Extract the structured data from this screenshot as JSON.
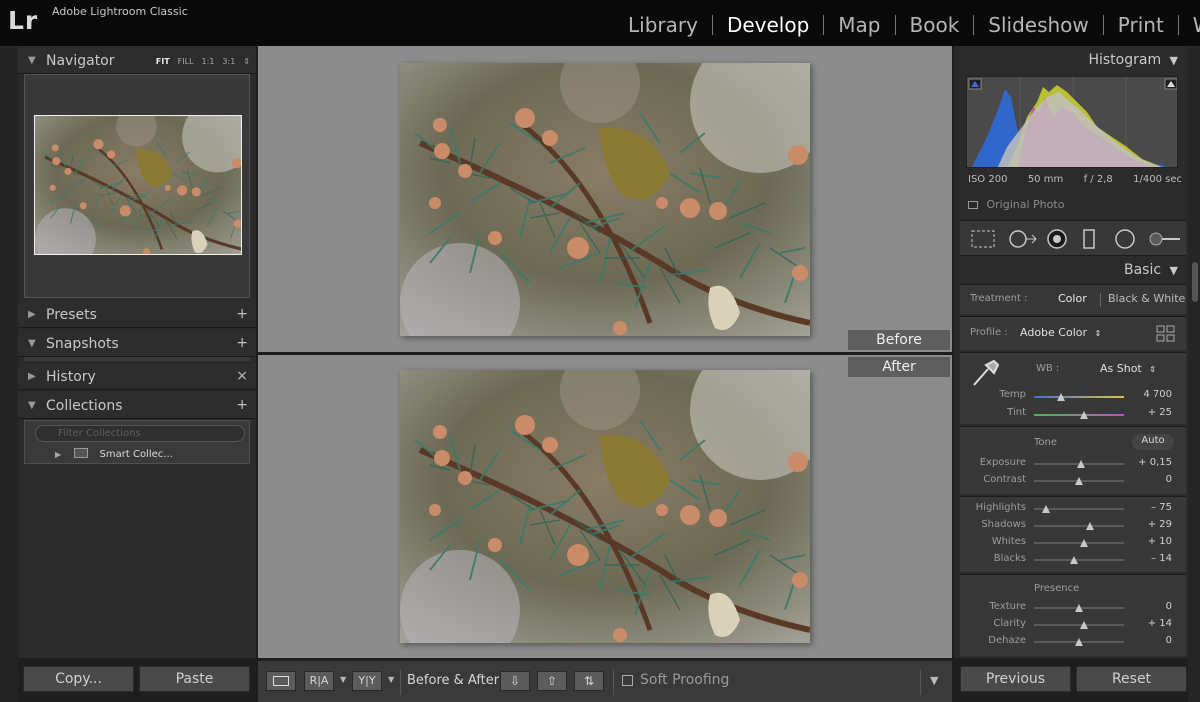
{
  "app": {
    "logo": "Lr",
    "name": "Adobe Lightroom Classic"
  },
  "modules": [
    {
      "label": "Library",
      "active": false
    },
    {
      "label": "Develop",
      "active": true
    },
    {
      "label": "Map",
      "active": false
    },
    {
      "label": "Book",
      "active": false
    },
    {
      "label": "Slideshow",
      "active": false
    },
    {
      "label": "Print",
      "active": false
    },
    {
      "label": "Web",
      "active": false
    }
  ],
  "left": {
    "navigator": {
      "title": "Navigator",
      "modes": [
        "FIT",
        "FILL",
        "1:1",
        "3:1"
      ]
    },
    "presets": {
      "title": "Presets",
      "action": "+"
    },
    "snapshots": {
      "title": "Snapshots",
      "action": "+"
    },
    "history": {
      "title": "History",
      "action": "×"
    },
    "collections": {
      "title": "Collections",
      "action": "+",
      "filter_placeholder": "Filter Collections",
      "items": [
        "Smart Collec..."
      ]
    },
    "copy_label": "Copy...",
    "paste_label": "Paste"
  },
  "center": {
    "before_label": "Before",
    "after_label": "After"
  },
  "toolbar": {
    "ra_label": "R|A",
    "yy_label": "Y|Y",
    "before_after_label": "Before & After :",
    "soft_proofing_label": "Soft Proofing"
  },
  "right": {
    "histogram": {
      "title": "Histogram",
      "iso": "ISO 200",
      "focal": "50 mm",
      "aperture": "f / 2,8",
      "shutter": "1/400 sec",
      "original_photo": "Original Photo"
    },
    "basic": {
      "title": "Basic",
      "treatment_label": "Treatment :",
      "treatment_color": "Color",
      "treatment_bw": "Black & White",
      "profile_label": "Profile :",
      "profile_value": "Adobe Color",
      "wb_label": "WB :",
      "wb_value": "As Shot",
      "temp": {
        "label": "Temp",
        "value": "4 700",
        "position": 0.3
      },
      "tint": {
        "label": "Tint",
        "value": "+ 25",
        "position": 0.56
      },
      "tone_label": "Tone",
      "auto_label": "Auto",
      "exposure": {
        "label": "Exposure",
        "value": "+ 0,15",
        "position": 0.52
      },
      "contrast": {
        "label": "Contrast",
        "value": "0",
        "position": 0.5
      },
      "highlights": {
        "label": "Highlights",
        "value": "– 75",
        "position": 0.13
      },
      "shadows": {
        "label": "Shadows",
        "value": "+ 29",
        "position": 0.62
      },
      "whites": {
        "label": "Whites",
        "value": "+ 10",
        "position": 0.55
      },
      "blacks": {
        "label": "Blacks",
        "value": "– 14",
        "position": 0.44
      },
      "presence_label": "Presence",
      "texture": {
        "label": "Texture",
        "value": "0",
        "position": 0.5
      },
      "clarity": {
        "label": "Clarity",
        "value": "+ 14",
        "position": 0.56
      },
      "dehaze": {
        "label": "Dehaze",
        "value": "0",
        "position": 0.5
      }
    },
    "previous_label": "Previous",
    "reset_label": "Reset"
  }
}
